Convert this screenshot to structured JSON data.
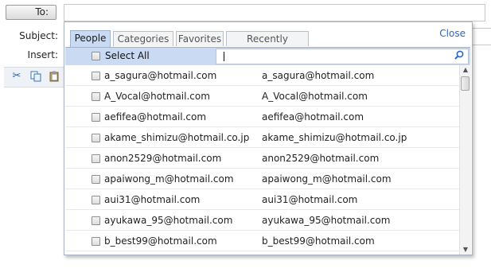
{
  "compose": {
    "to_label": "To:",
    "subject_label": "Subject:",
    "insert_label": "Insert:"
  },
  "toolbar": {
    "icons": [
      "scissors-icon",
      "copy-icon",
      "paste-icon"
    ]
  },
  "popup": {
    "tabs": [
      {
        "label": "People",
        "active": true
      },
      {
        "label": "Categories",
        "active": false
      },
      {
        "label": "Favorites",
        "active": false
      },
      {
        "label": "Recently emailed",
        "active": false
      }
    ],
    "close_label": "Close",
    "select_all_label": "Select All",
    "search_value": ""
  },
  "contacts": [
    {
      "email": "a_sagura@hotmail.com",
      "name": "a_sagura@hotmail.com"
    },
    {
      "email": "A_Vocal@hotmail.com",
      "name": "A_Vocal@hotmail.com"
    },
    {
      "email": "aefifea@hotmail.com",
      "name": "aefifea@hotmail.com"
    },
    {
      "email": "akame_shimizu@hotmail.co.jp",
      "name": "akame_shimizu@hotmail.co.jp"
    },
    {
      "email": "anon2529@hotmail.com",
      "name": "anon2529@hotmail.com"
    },
    {
      "email": "apaiwong_m@hotmail.com",
      "name": "apaiwong_m@hotmail.com"
    },
    {
      "email": "aui31@hotmail.com",
      "name": "aui31@hotmail.com"
    },
    {
      "email": "ayukawa_95@hotmail.com",
      "name": "ayukawa_95@hotmail.com"
    },
    {
      "email": "b_best99@hotmail.com",
      "name": "b_best99@hotmail.com"
    }
  ],
  "colors": {
    "accent": "#2a66c2",
    "tab_active_bg": "#c9daf2"
  }
}
